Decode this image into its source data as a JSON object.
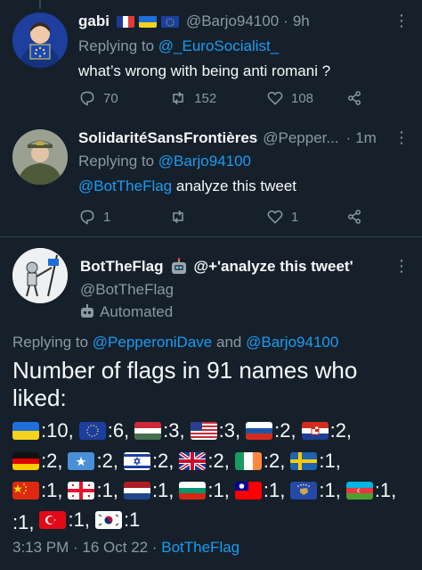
{
  "tweet1": {
    "name": "gabi",
    "handle": "@Barjo94100",
    "time": "9h",
    "replying_prefix": "Replying to",
    "replying_to": "@_EuroSocialist_",
    "text": "what’s wrong with being anti romani ?",
    "reply_count": "70",
    "retweet_count": "152",
    "like_count": "108"
  },
  "tweet2": {
    "name": "SolidaritéSansFrontières",
    "handle": "@Pepper...",
    "time": "1m",
    "replying_prefix": "Replying to",
    "replying_to": "@Barjo94100",
    "mention": "@BotTheFlag",
    "text": " analyze this tweet",
    "reply_count": "1",
    "like_count": "1"
  },
  "tweet3": {
    "name": "BotTheFlag",
    "name_suffix": "@+'analyze this tweet'",
    "handle": "@BotTheFlag",
    "automated": "Automated",
    "replying_prefix": "Replying to",
    "replying_to_1": "@PepperoniDave",
    "replying_and": "and",
    "replying_to_2": "@Barjo94100",
    "text_line1": "Number of flags in 91 names who",
    "text_line2": "liked:",
    "flag_counts": [
      {
        "flag": "ukraine",
        "count": ":10,"
      },
      {
        "flag": "eu",
        "count": ":6,"
      },
      {
        "flag": "hungary",
        "count": ":3,"
      },
      {
        "flag": "usa",
        "count": ":3,"
      },
      {
        "flag": "russia",
        "count": ":2,"
      },
      {
        "flag": "croatia",
        "count": ":2,"
      },
      {
        "flag": "germany",
        "count": ":2,"
      },
      {
        "flag": "somalia",
        "count": ":2,"
      },
      {
        "flag": "israel",
        "count": ":2,"
      },
      {
        "flag": "uk",
        "count": ":2,"
      },
      {
        "flag": "ireland",
        "count": ":2,"
      },
      {
        "flag": "sweden",
        "count": ":1,"
      },
      {
        "flag": "china",
        "count": ":1,"
      },
      {
        "flag": "georgia",
        "count": ":1,"
      },
      {
        "flag": "netherlands",
        "count": ":1,"
      },
      {
        "flag": "bulgaria",
        "count": ":1,"
      },
      {
        "flag": "taiwan",
        "count": ":1,"
      },
      {
        "flag": "kosovo",
        "count": ":1,"
      },
      {
        "flag": "azerbaijan",
        "count": ":1,"
      },
      {
        "flag": "blank",
        "count": ":1,"
      },
      {
        "flag": "turkey",
        "count": ":1,"
      },
      {
        "flag": "south-korea",
        "count": ":1"
      }
    ],
    "timestamp": "3:13 PM · 16 Oct 22 · ",
    "source": "BotTheFlag"
  },
  "colors": {
    "background": "#15202b",
    "text": "#f7f9f9",
    "muted": "#8b98a5",
    "link": "#1d9bf0"
  }
}
